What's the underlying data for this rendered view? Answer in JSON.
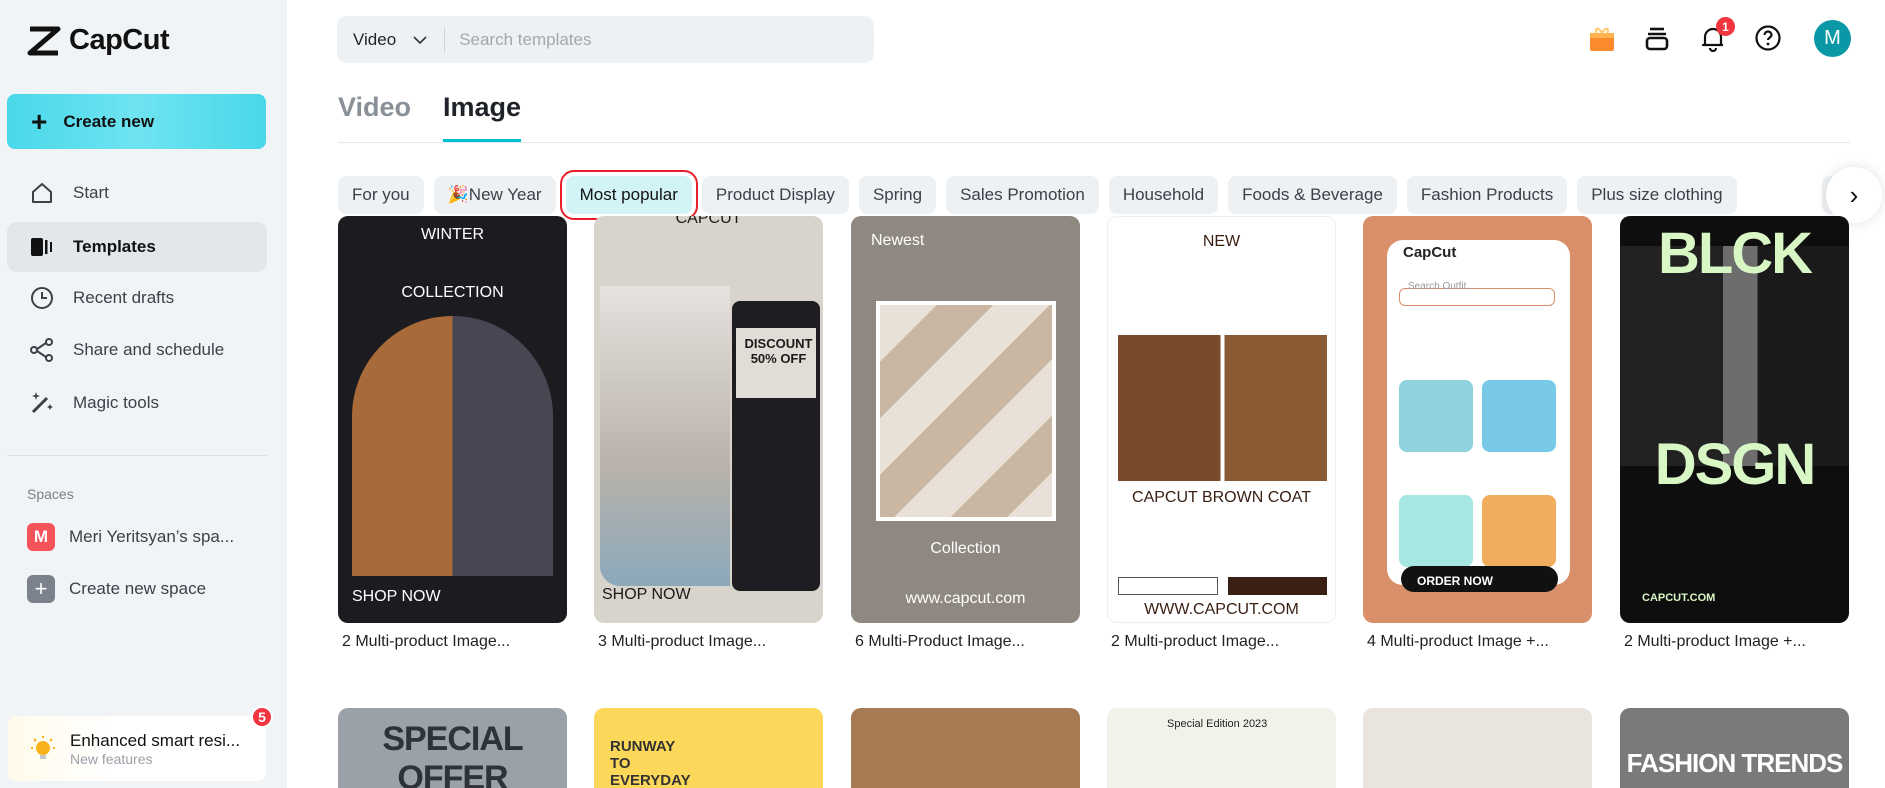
{
  "app": {
    "name": "CapCut"
  },
  "sidebar": {
    "create_new": "Create new",
    "items": [
      {
        "label": "Start",
        "icon": "home-icon"
      },
      {
        "label": "Templates",
        "icon": "templates-icon",
        "active": true
      },
      {
        "label": "Recent drafts",
        "icon": "clock-icon"
      },
      {
        "label": "Share and schedule",
        "icon": "share-icon"
      },
      {
        "label": "Magic tools",
        "icon": "magic-wand-icon"
      }
    ],
    "spaces_heading": "Spaces",
    "spaces": [
      {
        "initial": "M",
        "label": "Meri Yeritsyan’s spa...",
        "color": "#f5535a"
      },
      {
        "initial": "+",
        "label": "Create new space",
        "color": "#7b828b"
      }
    ],
    "feature": {
      "title": "Enhanced smart resi...",
      "subtitle": "New features",
      "badge": "5"
    }
  },
  "header": {
    "search_type": "Video",
    "search_placeholder": "Search templates",
    "notification_count": "1",
    "avatar_initial": "M"
  },
  "tabs": [
    {
      "label": "Video",
      "active": false
    },
    {
      "label": "Image",
      "active": true
    }
  ],
  "chips": [
    {
      "label": "For you"
    },
    {
      "label": "🎉New Year"
    },
    {
      "label": "Most popular",
      "active": true
    },
    {
      "label": "Product Display"
    },
    {
      "label": "Spring"
    },
    {
      "label": "Sales Promotion"
    },
    {
      "label": "Household"
    },
    {
      "label": "Foods & Beverage"
    },
    {
      "label": "Fashion Products"
    },
    {
      "label": "Plus size clothing"
    }
  ],
  "colors": {
    "accent": "#00c2d4",
    "create_button": "#49d8ea",
    "active_chip": "#d2f4f7",
    "highlight": "#e8202a"
  },
  "cards_row1": [
    {
      "caption": "2 Multi-product Image...",
      "headline": "WINTER",
      "sub": "COLLECTION",
      "footer": "SHOP NOW",
      "bg": "#1c1b20",
      "fg": "#ffffff"
    },
    {
      "caption": "3 Multi-product Image...",
      "headline": "CAPCUT",
      "sub": "DISCOUNT 50% OFF",
      "footer": "SHOP NOW",
      "bg": "#d8d4cc",
      "fg": "#1a1a1a"
    },
    {
      "caption": "6 Multi-Product Image...",
      "headline": "Newest",
      "sub": "Collection",
      "footer": "www.capcut.com",
      "bg": "#8e8880",
      "fg": "#ffffff"
    },
    {
      "caption": "2 Multi-product Image...",
      "headline": "NEW",
      "sub": "CAPCUT BROWN COAT",
      "footer": "WWW.CAPCUT.COM",
      "bg": "#ffffff",
      "fg": "#3a2014"
    },
    {
      "caption": "4 Multi-product Image +...",
      "headline": "CapCut",
      "sub": "Search Outfit...",
      "footer": "ORDER NOW",
      "bg": "#d98f6a",
      "fg": "#222222"
    },
    {
      "caption": "2 Multi-product Image +...",
      "headline": "BLCK",
      "sub": "DSGN",
      "footer": "CAPCUT.COM",
      "bg": "#0e0e0e",
      "fg": "#d9f7c5"
    }
  ],
  "cards_row2": [
    {
      "headline": "SPECIAL OFFER",
      "bg": "#9aa1a8",
      "fg": "#2d3338"
    },
    {
      "headline": "RUNWAY TO EVERYDAY",
      "bg": "#fbd85a",
      "fg": "#333333"
    },
    {
      "headline": "",
      "bg": "#a67a52",
      "fg": "#ffffff"
    },
    {
      "headline": "Special Edition 2023",
      "bg": "#f3f2ea",
      "fg": "#222222"
    },
    {
      "headline": "",
      "bg": "#e9e4dd",
      "fg": "#222222"
    },
    {
      "headline": "FASHION TRENDS",
      "bg": "#7a7a7a",
      "fg": "#ffffff"
    }
  ]
}
